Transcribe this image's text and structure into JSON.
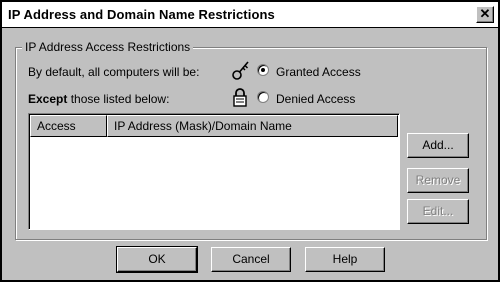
{
  "window": {
    "title": "IP Address and Domain Name Restrictions",
    "close_glyph": "✕"
  },
  "group": {
    "label": "IP Address Access Restrictions",
    "default_text": "By default, all computers will be:",
    "except_bold": "Except",
    "except_rest": " those listed below:",
    "granted_label": "Granted Access",
    "denied_label": "Denied Access",
    "selected": "granted"
  },
  "list": {
    "columns": [
      "Access",
      "IP Address (Mask)/Domain Name"
    ],
    "rows": []
  },
  "side_buttons": {
    "add": "Add...",
    "remove": "Remove",
    "edit": "Edit..."
  },
  "footer_buttons": {
    "ok": "OK",
    "cancel": "Cancel",
    "help": "Help"
  },
  "icons": {
    "key": "key-icon",
    "lock": "lock-icon"
  }
}
